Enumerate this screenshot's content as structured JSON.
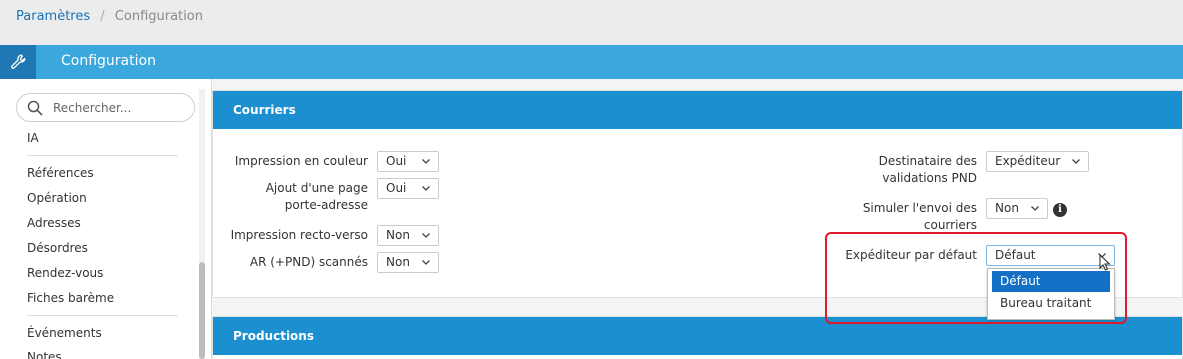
{
  "breadcrumb": {
    "parent": "Paramètres",
    "current": "Configuration"
  },
  "header": {
    "title": "Configuration",
    "icon": "wrench-icon"
  },
  "sidebar": {
    "search_placeholder": "Rechercher...",
    "items": [
      "IA",
      "Références",
      "Opération",
      "Adresses",
      "Désordres",
      "Rendez-vous",
      "Fiches barème",
      "Événements",
      "Notes"
    ]
  },
  "courriers": {
    "title": "Courriers",
    "left_fields": [
      {
        "label": "Impression en couleur",
        "value": "Oui"
      },
      {
        "label": "Ajout d'une page porte-adresse",
        "value": "Oui"
      },
      {
        "label": "Impression recto-verso",
        "value": "Non"
      },
      {
        "label": "AR (+PND) scannés",
        "value": "Non"
      }
    ],
    "destinataire": {
      "label": "Destinataire des validations PND",
      "value": "Expéditeur"
    },
    "simuler": {
      "label": "Simuler l'envoi des courriers",
      "value": "Non"
    },
    "expediteur": {
      "label": "Expéditeur par défaut",
      "value": "Défaut",
      "options": [
        "Défaut",
        "Bureau traitant"
      ]
    }
  },
  "productions": {
    "title": "Productions"
  },
  "colors": {
    "accent": "#3aa7dd",
    "panel_header": "#1b8fd0",
    "highlight": "#e0192b"
  }
}
